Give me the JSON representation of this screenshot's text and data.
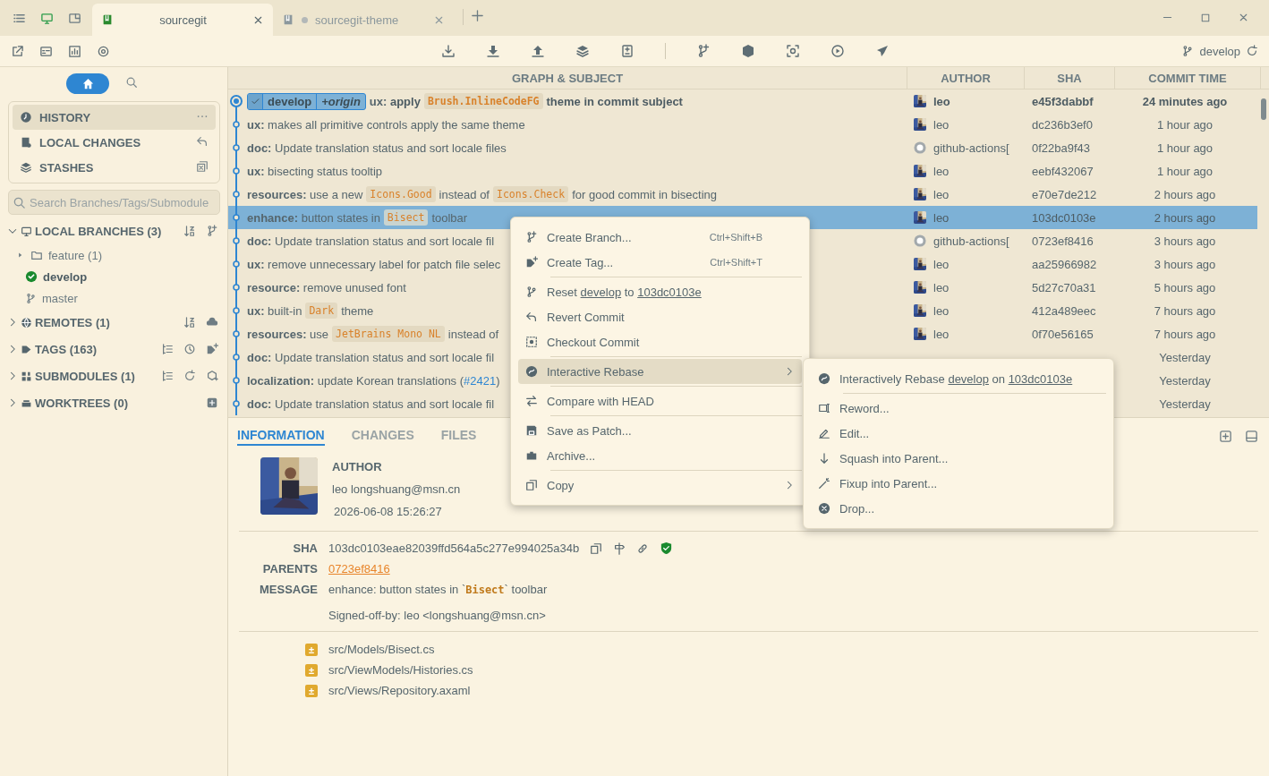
{
  "window": {
    "tabs": [
      {
        "label": "sourcegit",
        "selected": true
      },
      {
        "label": "sourcegit-theme",
        "selected": false
      }
    ]
  },
  "toolbar": {
    "branch": "develop"
  },
  "sidebar": {
    "views": [
      {
        "label": "HISTORY",
        "selected": true
      },
      {
        "label": "LOCAL CHANGES",
        "selected": false
      },
      {
        "label": "STASHES",
        "selected": false
      }
    ],
    "search": {
      "placeholder": "Search Branches/Tags/Submodule"
    },
    "sections": [
      {
        "label": "LOCAL BRANCHES (3)",
        "expanded": true,
        "children": [
          {
            "label": "feature (1)",
            "kind": "folder",
            "expanded": false
          },
          {
            "label": "develop",
            "kind": "branch",
            "current": true
          },
          {
            "label": "master",
            "kind": "branch",
            "current": false
          }
        ]
      },
      {
        "label": "REMOTES (1)",
        "expanded": false
      },
      {
        "label": "TAGS (163)",
        "expanded": false
      },
      {
        "label": "SUBMODULES (1)",
        "expanded": false
      },
      {
        "label": "WORKTREES (0)",
        "expanded": false
      }
    ]
  },
  "table": {
    "columns": [
      "GRAPH & SUBJECT",
      "AUTHOR",
      "SHA",
      "COMMIT TIME"
    ],
    "rows": [
      {
        "head": true,
        "selected": false,
        "refs": [
          {
            "label": "develop",
            "kind": "local",
            "current": true
          },
          {
            "label": "+origin",
            "kind": "remote"
          }
        ],
        "parts": [
          {
            "kind": "text",
            "text": "**ux:** apply"
          },
          {
            "kind": "code",
            "text": "Brush.InlineCodeFG"
          },
          {
            "kind": "text",
            "text": "theme in commit subject"
          }
        ],
        "author": "leo",
        "bot_avatar": false,
        "sha": "e45f3dabbf",
        "time": "24 minutes ago"
      },
      {
        "head": false,
        "selected": false,
        "parts": [
          {
            "kind": "text",
            "text": "**ux:** makes all primitive controls apply the same theme"
          }
        ],
        "author": "leo",
        "bot_avatar": false,
        "sha": "dc236b3ef0",
        "time": "1 hour ago"
      },
      {
        "head": false,
        "selected": false,
        "parts": [
          {
            "kind": "text",
            "text": "**doc:** Update translation status and sort locale files"
          }
        ],
        "author": "github-actions[",
        "bot_avatar": true,
        "sha": "0f22ba9f43",
        "time": "1 hour ago"
      },
      {
        "head": false,
        "selected": false,
        "parts": [
          {
            "kind": "text",
            "text": "**ux:** bisecting status tooltip"
          }
        ],
        "author": "leo",
        "bot_avatar": false,
        "sha": "eebf432067",
        "time": "1 hour ago"
      },
      {
        "head": false,
        "selected": false,
        "parts": [
          {
            "kind": "text",
            "text": "**resources:** use a new"
          },
          {
            "kind": "code",
            "text": "Icons.Good"
          },
          {
            "kind": "text",
            "text": "instead of"
          },
          {
            "kind": "code",
            "text": "Icons.Check"
          },
          {
            "kind": "text",
            "text": "for good commit in bisecting"
          }
        ],
        "author": "leo",
        "bot_avatar": false,
        "sha": "e70e7de212",
        "time": "2 hours ago"
      },
      {
        "head": false,
        "selected": true,
        "parts": [
          {
            "kind": "text",
            "text": "**enhance:** button states in"
          },
          {
            "kind": "code",
            "text": "Bisect"
          },
          {
            "kind": "text",
            "text": "toolbar"
          }
        ],
        "author": "leo",
        "bot_avatar": false,
        "sha": "103dc0103e",
        "time": "2 hours ago"
      },
      {
        "head": false,
        "selected": false,
        "parts": [
          {
            "kind": "text",
            "text": "**doc:** Update translation status and sort locale fil"
          }
        ],
        "author": "github-actions[",
        "bot_avatar": true,
        "sha": "0723ef8416",
        "time": "3 hours ago"
      },
      {
        "head": false,
        "selected": false,
        "parts": [
          {
            "kind": "text",
            "text": "**ux:** remove unnecessary label for patch file selec"
          }
        ],
        "author": "leo",
        "bot_avatar": false,
        "sha": "aa25966982",
        "time": "3 hours ago"
      },
      {
        "head": false,
        "selected": false,
        "parts": [
          {
            "kind": "text",
            "text": "**resource:** remove unused font"
          }
        ],
        "author": "leo",
        "bot_avatar": false,
        "sha": "5d27c70a31",
        "time": "5 hours ago"
      },
      {
        "head": false,
        "selected": false,
        "parts": [
          {
            "kind": "text",
            "text": "**ux:** built-in"
          },
          {
            "kind": "code",
            "text": "Dark"
          },
          {
            "kind": "text",
            "text": "theme"
          }
        ],
        "author": "leo",
        "bot_avatar": false,
        "sha": "412a489eec",
        "time": "7 hours ago"
      },
      {
        "head": false,
        "selected": false,
        "parts": [
          {
            "kind": "text",
            "text": "**resources:** use"
          },
          {
            "kind": "code",
            "text": "JetBrains Mono NL"
          },
          {
            "kind": "text",
            "text": "instead of"
          }
        ],
        "author": "leo",
        "bot_avatar": false,
        "sha": "0f70e56165",
        "time": "7 hours ago"
      },
      {
        "head": false,
        "selected": false,
        "parts": [
          {
            "kind": "text",
            "text": "**doc:** Update translation status and sort locale fil"
          }
        ],
        "time": "Yesterday"
      },
      {
        "head": false,
        "selected": false,
        "parts": [
          {
            "kind": "text",
            "text": "**localization:** update Korean translations ("
          },
          {
            "kind": "link",
            "text": "#2421"
          },
          {
            "kind": "tail",
            "text": ")"
          }
        ],
        "time": "Yesterday"
      },
      {
        "head": false,
        "selected": false,
        "parts": [
          {
            "kind": "text",
            "text": "**doc:** Update translation status and sort locale fil"
          }
        ],
        "time": "Yesterday"
      }
    ]
  },
  "detail": {
    "tabs": [
      {
        "label": "INFORMATION",
        "selected": true
      },
      {
        "label": "CHANGES",
        "selected": false
      },
      {
        "label": "FILES",
        "selected": false
      }
    ],
    "author": {
      "heading": "AUTHOR",
      "name": "leo",
      "email": "longshuang@msn.cn",
      "date": "2026-06-08 15:26:27"
    },
    "sha": {
      "label": "SHA",
      "value": "103dc0103eae82039ffd564a5c277e994025a34b"
    },
    "parents": {
      "label": "PARENTS",
      "value": "0723ef8416"
    },
    "message": {
      "label": "MESSAGE",
      "parts": [
        {
          "kind": "text",
          "text": "enhance: button states in `"
        },
        {
          "kind": "code",
          "text": "Bisect"
        },
        {
          "kind": "text",
          "text": "` toolbar"
        }
      ],
      "body": "Signed-off-by: leo <longshuang@msn.cn>"
    },
    "files": [
      {
        "status": "±",
        "path": "src/Models/Bisect.cs"
      },
      {
        "status": "±",
        "path": "src/ViewModels/Histories.cs"
      },
      {
        "status": "±",
        "path": "src/Views/Repository.axaml"
      }
    ]
  },
  "context_menu": {
    "items": [
      {
        "kind": "item",
        "label": "Create Branch...",
        "shortcut": "Ctrl+Shift+B"
      },
      {
        "kind": "item",
        "label": "Create Tag...",
        "shortcut": "Ctrl+Shift+T"
      },
      {
        "kind": "separator"
      },
      {
        "kind": "item",
        "parts": [
          {
            "text": "Reset ",
            "underline": false
          },
          {
            "text": "develop",
            "underline": true
          },
          {
            "text": " to ",
            "underline": false
          },
          {
            "text": "103dc0103e",
            "underline": true
          }
        ]
      },
      {
        "kind": "item",
        "label": "Revert Commit"
      },
      {
        "kind": "item",
        "label": "Checkout Commit"
      },
      {
        "kind": "separator"
      },
      {
        "kind": "item",
        "label": "Interactive Rebase",
        "submenu": true,
        "selected": true
      },
      {
        "kind": "separator"
      },
      {
        "kind": "item",
        "label": "Compare with HEAD"
      },
      {
        "kind": "separator"
      },
      {
        "kind": "item",
        "label": "Save as Patch..."
      },
      {
        "kind": "item",
        "label": "Archive..."
      },
      {
        "kind": "separator"
      },
      {
        "kind": "item",
        "label": "Copy",
        "submenu": true
      }
    ]
  },
  "submenu": {
    "items": [
      {
        "kind": "item",
        "parts": [
          {
            "text": "Interactively Rebase ",
            "underline": false
          },
          {
            "text": "develop",
            "underline": true
          },
          {
            "text": " on ",
            "underline": false
          },
          {
            "text": "103dc0103e",
            "underline": true
          }
        ]
      },
      {
        "kind": "separator"
      },
      {
        "kind": "item",
        "label": "Reword..."
      },
      {
        "kind": "item",
        "label": "Edit..."
      },
      {
        "kind": "item",
        "label": "Squash into Parent..."
      },
      {
        "kind": "item",
        "label": "Fixup into Parent..."
      },
      {
        "kind": "item",
        "label": "Drop..."
      }
    ]
  }
}
